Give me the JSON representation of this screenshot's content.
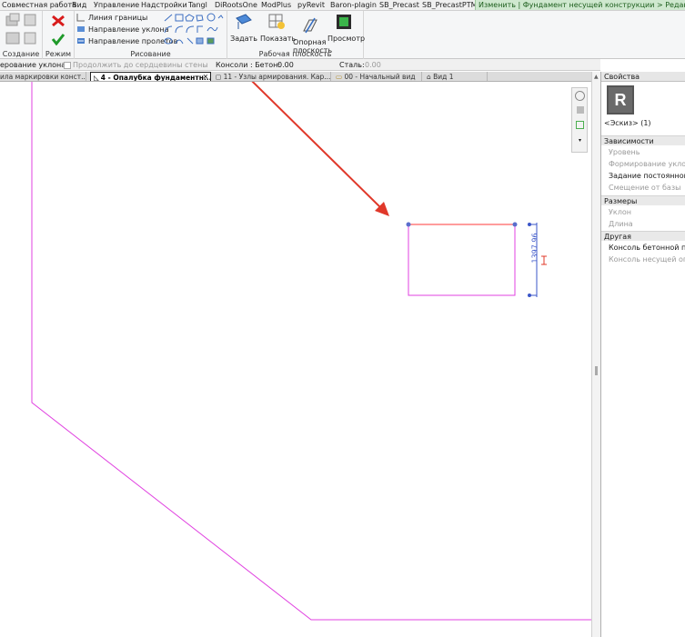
{
  "menubar": {
    "items": [
      "Совместная работа",
      "Вид",
      "Управление",
      "Надстройки",
      "Tangl",
      "DiRootsOne",
      "ModPlus",
      "pyRevit",
      "Baron-plagin",
      "SB_Precast",
      "SB_PrecastPTM"
    ],
    "context_tab": "Изменить | Фундамент несущей конструкции > Редактирование"
  },
  "ribbon": {
    "create_label": "Создание",
    "mode_label": "Режим",
    "draw_label": "Рисование",
    "workplane_label": "Рабочая плоскость",
    "boundary_line": "Линия границы",
    "slope_arrow": "Направление уклона",
    "span_direction": "Направление пролетов",
    "set_label": "Задать",
    "show_label": "Показать",
    "ref_plane_label": "Опорная плоскость",
    "viewer_label": "Просмотр"
  },
  "options_bar": {
    "slope_label": "ерование уклона",
    "extend_checkbox": "Продолжить до сердцевины стены",
    "console_concrete_label": "Консоли : Бетон:",
    "console_concrete_value": "0.00",
    "steel_label": "Сталь:",
    "steel_value": "0.00"
  },
  "tabs": [
    {
      "label": "ила маркировки конст...",
      "active": false
    },
    {
      "label": "4 - Опалубка фундаментн...",
      "active": true
    },
    {
      "label": "11 - Узлы армирования. Кар...",
      "active": false
    },
    {
      "label": "00 - Начальный вид",
      "active": false
    },
    {
      "label": "Вид 1",
      "active": false
    }
  ],
  "canvas": {
    "dimension_text": "1397.96",
    "colors": {
      "sketch_magenta": "#e040e0",
      "annotation_red": "#e0382a",
      "dimension_blue": "#3a55c8"
    }
  },
  "properties": {
    "title": "Свойства",
    "selection": "<Эскиз> (1)",
    "groups": [
      {
        "name": "Зависимости",
        "rows": [
          {
            "label": "Уровень",
            "dim": true
          },
          {
            "label": "Формирование уклона",
            "dim": true
          },
          {
            "label": "Задание постоянной в",
            "dim": false
          },
          {
            "label": "Смещение от базы",
            "dim": true
          }
        ]
      },
      {
        "name": "Размеры",
        "rows": [
          {
            "label": "Уклон",
            "dim": true
          },
          {
            "label": "Длина",
            "dim": true
          }
        ]
      },
      {
        "name": "Другая",
        "rows": [
          {
            "label": "Консоль бетонной пл",
            "dim": false
          },
          {
            "label": "Консоль несущей опа",
            "dim": true
          }
        ]
      }
    ]
  }
}
